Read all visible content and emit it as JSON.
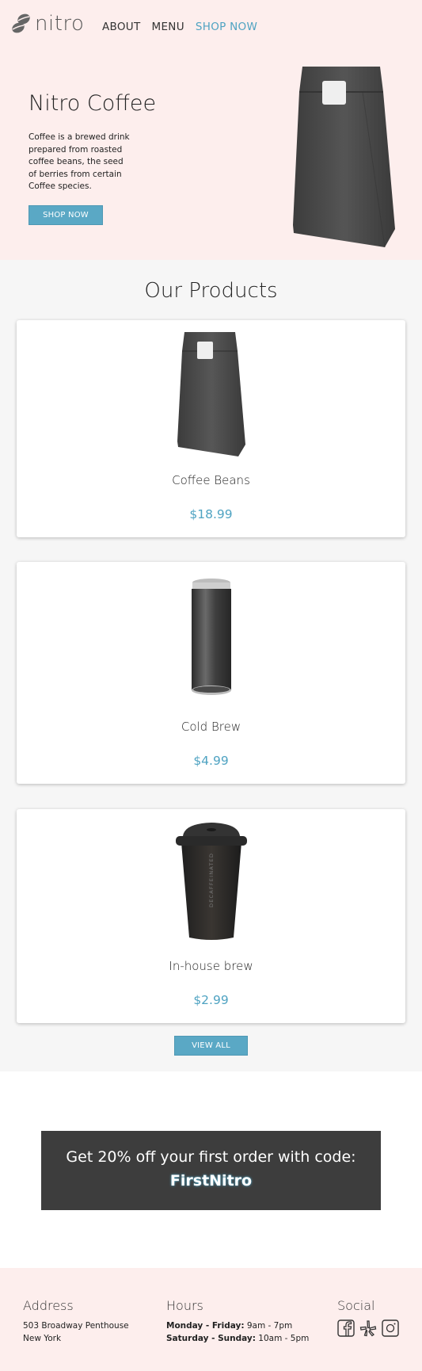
{
  "brand": {
    "name": "nitro"
  },
  "nav": {
    "items": [
      "ABOUT",
      "MENU",
      "SHOP NOW"
    ],
    "active_index": 2
  },
  "hero": {
    "title": "Nitro Coffee",
    "description": "Coffee is a brewed drink prepared from roasted coffee beans, the seed of berries from certain Coffee species.",
    "button": "SHOP NOW"
  },
  "products": {
    "title": "Our Products",
    "items": [
      {
        "name": "Coffee Beans",
        "price": "$18.99",
        "icon": "coffee-bag-icon"
      },
      {
        "name": "Cold Brew",
        "price": "$4.99",
        "icon": "can-icon"
      },
      {
        "name": "In-house brew",
        "price": "$2.99",
        "icon": "coffee-cup-icon"
      }
    ],
    "view_all": "VIEW ALL"
  },
  "promo": {
    "text": "Get 20% off your first order with code:",
    "code": "FirstNitro"
  },
  "footer": {
    "address": {
      "heading": "Address",
      "line1": "503 Broadway Penthouse",
      "line2": "New York"
    },
    "hours": {
      "heading": "Hours",
      "rows": [
        {
          "label": "Monday - Friday:",
          "value": "9am - 7pm"
        },
        {
          "label": "Saturday - Sunday:",
          "value": "10am - 5pm"
        }
      ]
    },
    "social": {
      "heading": "Social",
      "icons": [
        "facebook-icon",
        "yelp-icon",
        "instagram-icon"
      ]
    }
  },
  "colors": {
    "accent": "#4fa3c2",
    "pink": "#fdeeed",
    "dark": "#3d3d3d"
  }
}
